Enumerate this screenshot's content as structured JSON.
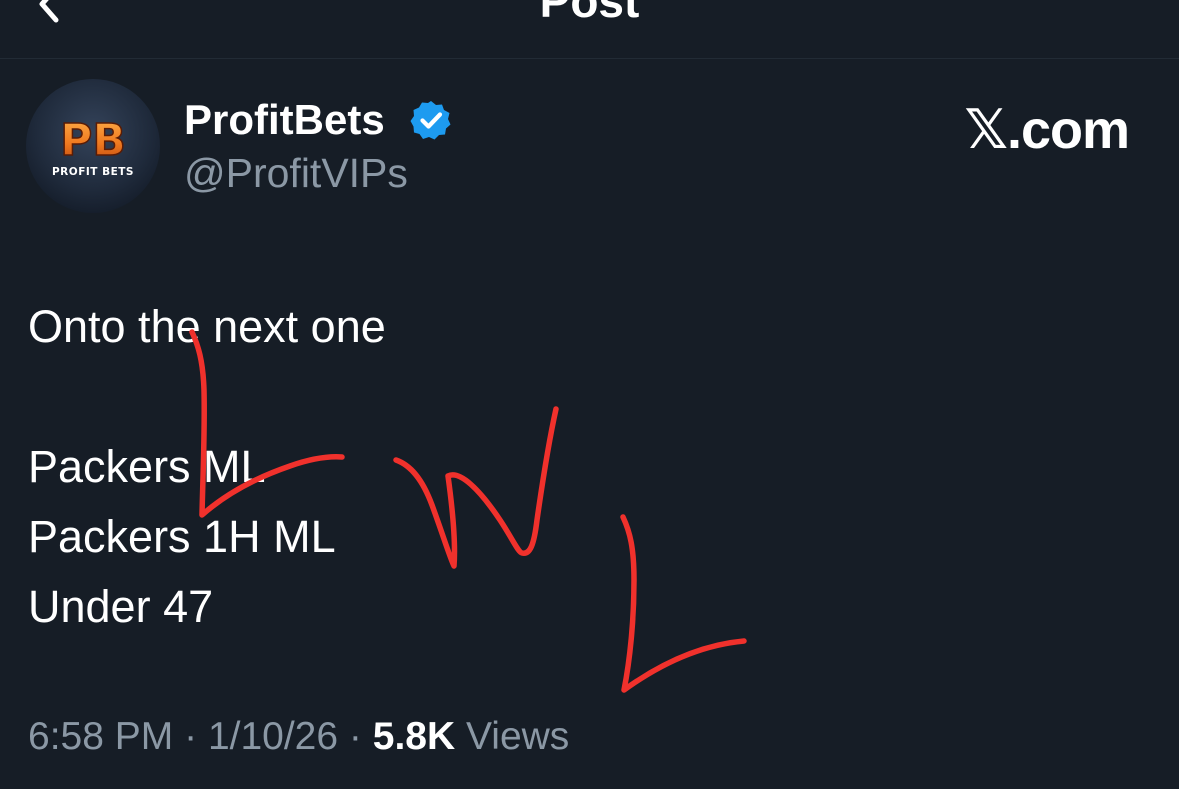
{
  "header": {
    "title": "Post",
    "back_icon": "chevron-left-icon"
  },
  "post": {
    "avatar": {
      "logo_letters": "PB",
      "logo_caption": "PROFIT BETS"
    },
    "display_name": "ProfitBets",
    "verified_icon": "verified-badge-icon",
    "verified_color": "#1d9bf0",
    "handle": "@ProfitVIPs",
    "source_label": "𝕏.com",
    "text_lines": [
      "Onto the next one",
      "",
      "Packers ML",
      "Packers 1H ML",
      "Under 47"
    ],
    "time": "6:58 PM",
    "date": "1/10/26",
    "separator": "·",
    "views_count": "5.8K",
    "views_label": "Views"
  },
  "annotations": {
    "marks": [
      "L",
      "W",
      "L"
    ],
    "color": "#f0312c"
  },
  "colors": {
    "background": "#161d26",
    "text": "#ffffff",
    "secondary_text": "#8b98a5",
    "logo_orange": "#f07a20"
  }
}
